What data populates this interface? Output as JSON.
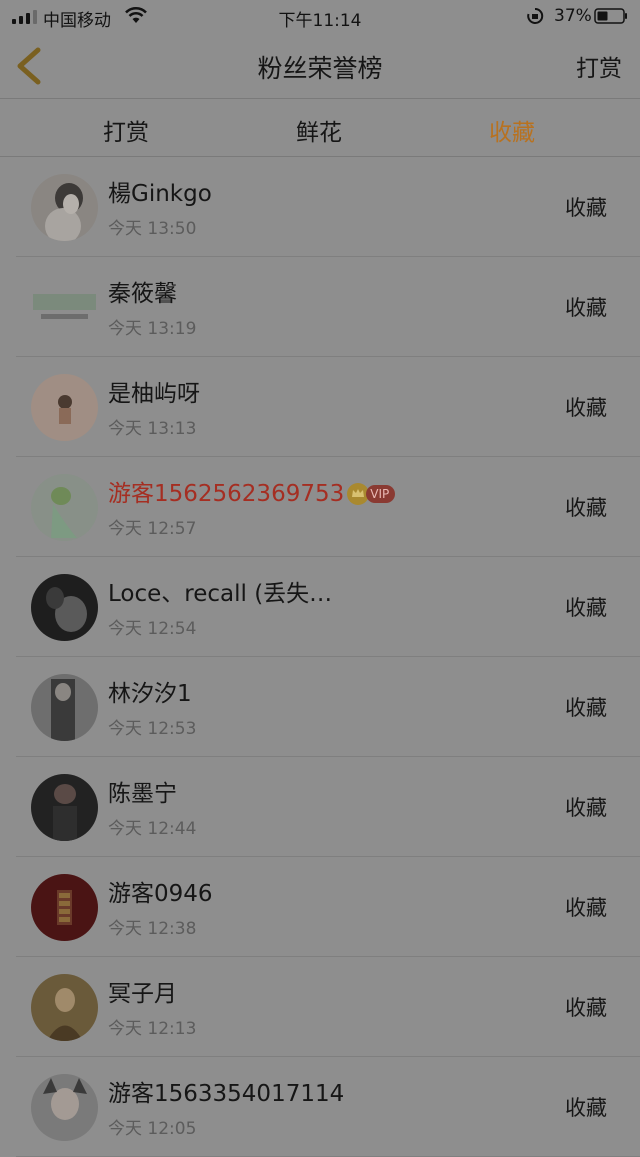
{
  "status_bar": {
    "carrier": "中国移动",
    "time": "下午11:14",
    "battery": "37%"
  },
  "nav": {
    "title": "粉丝荣誉榜",
    "action": "打赏"
  },
  "tabs": [
    {
      "label": "打赏",
      "active": false
    },
    {
      "label": "鲜花",
      "active": false
    },
    {
      "label": "收藏",
      "active": true
    }
  ],
  "colors": {
    "active_tab": "#b87220",
    "vip_name": "#a52e22"
  },
  "rows": [
    {
      "name": "楊Ginkgo",
      "time": "今天 13:50",
      "action": "收藏"
    },
    {
      "name": "秦筱馨",
      "time": "今天 13:19",
      "action": "收藏"
    },
    {
      "name": "是柚屿呀",
      "time": "今天 13:13",
      "action": "收藏"
    },
    {
      "name": "游客1562562369753",
      "time": "今天 12:57",
      "action": "收藏",
      "vip": "VIP"
    },
    {
      "name": "Loce、recall (丢失…",
      "time": "今天 12:54",
      "action": "收藏"
    },
    {
      "name": "林汐汐1",
      "time": "今天 12:53",
      "action": "收藏"
    },
    {
      "name": "陈墨宁",
      "time": "今天 12:44",
      "action": "收藏"
    },
    {
      "name": "游客0946",
      "time": "今天 12:38",
      "action": "收藏"
    },
    {
      "name": "冥子月",
      "time": "今天 12:13",
      "action": "收藏"
    },
    {
      "name": "游客1563354017114",
      "time": "今天 12:05",
      "action": "收藏"
    }
  ]
}
